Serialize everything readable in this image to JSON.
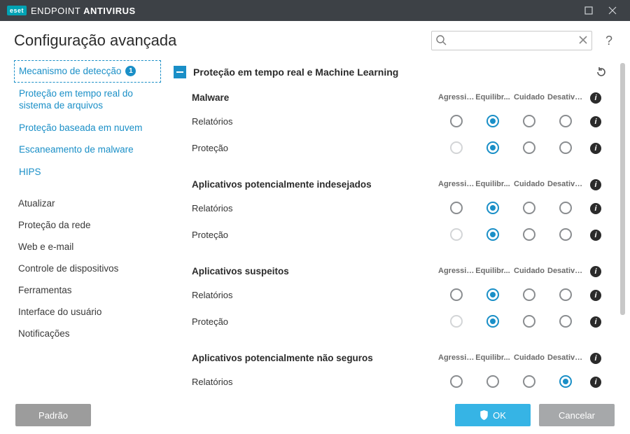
{
  "app": {
    "brand_badge": "eset",
    "brand_light": "ENDPOINT ",
    "brand_bold": "ANTIVIRUS"
  },
  "header": {
    "title": "Configuração avançada",
    "search_placeholder": ""
  },
  "sidebar": {
    "active": {
      "label": "Mecanismo de detecção",
      "badge": "1"
    },
    "sub": [
      "Proteção em tempo real do sistema de arquivos",
      "Proteção baseada em nuvem",
      "Escaneamento de malware",
      "HIPS"
    ],
    "others": [
      "Atualizar",
      "Proteção da rede",
      "Web e e-mail",
      "Controle de dispositivos",
      "Ferramentas",
      "Interface do usuário",
      "Notificações"
    ]
  },
  "section": {
    "title": "Proteção em tempo real e Machine Learning",
    "columns": [
      "Agressivo",
      "Equilibr...",
      "Cuidado",
      "Desativa..."
    ]
  },
  "categories": [
    {
      "name": "Malware",
      "rows": [
        {
          "label": "Relatórios",
          "selected": 1,
          "disabled": []
        },
        {
          "label": "Proteção",
          "selected": 1,
          "disabled": [
            0
          ]
        }
      ]
    },
    {
      "name": "Aplicativos potencialmente indesejados",
      "rows": [
        {
          "label": "Relatórios",
          "selected": 1,
          "disabled": []
        },
        {
          "label": "Proteção",
          "selected": 1,
          "disabled": [
            0
          ]
        }
      ]
    },
    {
      "name": "Aplicativos suspeitos",
      "rows": [
        {
          "label": "Relatórios",
          "selected": 1,
          "disabled": []
        },
        {
          "label": "Proteção",
          "selected": 1,
          "disabled": [
            0
          ]
        }
      ]
    },
    {
      "name": "Aplicativos potencialmente não seguros",
      "rows": [
        {
          "label": "Relatórios",
          "selected": 3,
          "disabled": []
        }
      ]
    }
  ],
  "footer": {
    "default_btn": "Padrão",
    "ok_btn": "OK",
    "cancel_btn": "Cancelar"
  }
}
